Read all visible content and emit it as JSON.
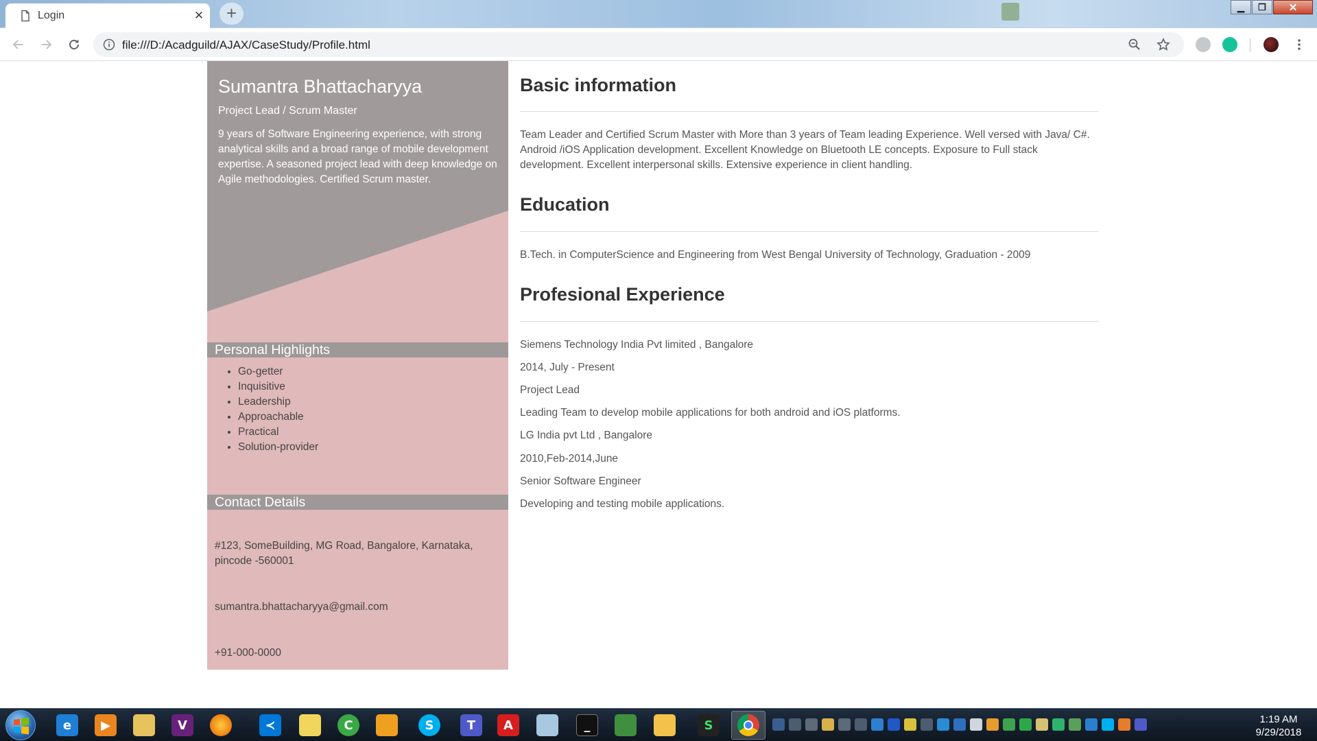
{
  "browser": {
    "tab_title": "Login",
    "url": "file:///D:/Acadguild/AJAX/CaseStudy/Profile.html"
  },
  "profile": {
    "name": "Sumantra Bhattacharyya",
    "role": "Project Lead / Scrum Master",
    "summary": "9 years of Software Engineering experience, with strong analytical skills and a broad range of mobile development expertise. A seasoned project lead with deep knowledge on Agile methodologies. Certified Scrum master.",
    "highlights_title": "Personal Highlights",
    "highlights": [
      "Go-getter",
      "Inquisitive",
      "Leadership",
      "Approachable",
      "Practical",
      "Solution-provider"
    ],
    "contact_title": "Contact Details",
    "contact": {
      "address": "#123, SomeBuilding, MG Road, Bangalore, Karnataka, pincode -560001",
      "email": "sumantra.bhattacharyya@gmail.com",
      "phone": "+91-000-0000"
    }
  },
  "main": {
    "basic_info": {
      "heading": "Basic information",
      "text": "Team Leader and Certified Scrum Master with More than 3 years of Team leading Experience. Well versed with Java/ C#. Android /iOS Application development. Excellent Knowledge on Bluetooth LE concepts. Exposure to Full stack development. Excellent interpersonal skills. Extensive experience in client handling."
    },
    "education": {
      "heading": "Education",
      "text": "B.Tech. in ComputerScience and Engineering from West Bengal University of Technology, Graduation - 2009"
    },
    "experience": {
      "heading": "Profesional Experience",
      "lines": [
        "Siemens Technology India Pvt limited , Bangalore",
        "2014, July - Present",
        "Project Lead",
        "Leading Team to develop mobile applications for both android and iOS platforms.",
        "LG India pvt Ltd , Bangalore",
        "2010,Feb-2014,June",
        "Senior Software Engineer",
        "Developing and testing mobile applications."
      ]
    }
  },
  "taskbar": {
    "apps": [
      "internet-explorer",
      "media-player",
      "file-explorer",
      "visual-studio",
      "firefox",
      "vs-code",
      "sticky-notes",
      "camtasia",
      "handshake-app",
      "skype",
      "teams",
      "acrobat",
      "notepad",
      "command-prompt",
      "spreadsheet-app",
      "outlook",
      "s-app",
      "chrome"
    ],
    "active_app": "chrome",
    "clock_time": "1:19 AM",
    "clock_date": "9/29/2018"
  },
  "colors": {
    "sidebar_pink": "#e0b9bb",
    "sidebar_gray": "#a19a9b",
    "section_bar": "#9e9898"
  }
}
